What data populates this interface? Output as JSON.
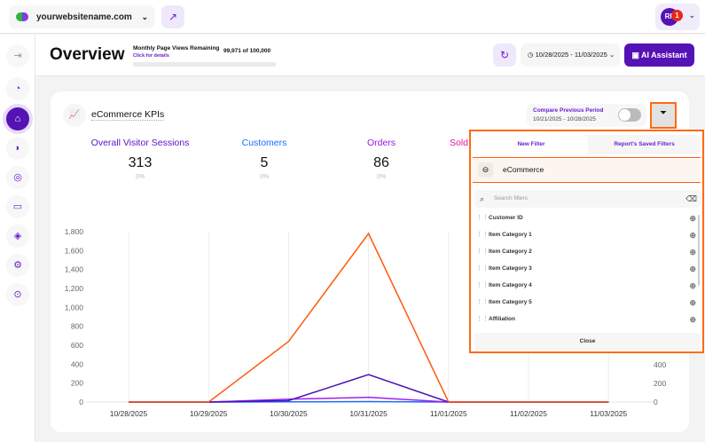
{
  "topbar": {
    "site": "yourwebsitename.com",
    "avatar_initials": "RF",
    "notification_count": "1"
  },
  "header": {
    "title": "Overview",
    "page_views_label": "Monthly Page Views Remaining",
    "page_views_link": "Click for details",
    "page_views_count": "99,971 of 100,000",
    "page_views_used_fraction": 0.0003,
    "date_range": "10/28/2025 - 11/03/2025",
    "ai_button": "AI Assistant"
  },
  "card": {
    "title": "eCommerce KPIs",
    "compare_label": "Compare Previous Period",
    "compare_range": "10/21/2025 - 10/28/2025",
    "compare_enabled": false,
    "kpis": [
      {
        "label": "Overall Visitor Sessions",
        "value": "313",
        "change": "0%",
        "color": "#5a0fc8"
      },
      {
        "label": "Customers",
        "value": "5",
        "change": "0%",
        "color": "#1a6bff"
      },
      {
        "label": "Orders",
        "value": "86",
        "change": "0%",
        "color": "#9b14e8"
      },
      {
        "label": "Sold",
        "value": "",
        "change": "",
        "color": "#e814a8"
      }
    ]
  },
  "filter_panel": {
    "tabs": [
      "New Filter",
      "Report's Saved Filters"
    ],
    "active_tab": "New Filter",
    "category": "eCommerce",
    "search_placeholder": "Search filters",
    "items": [
      "Customer ID",
      "Item Category 1",
      "Item Category 2",
      "Item Category 3",
      "Item Category 4",
      "Item Category 5",
      "Affiliation"
    ],
    "close": "Close"
  },
  "chart_data": {
    "type": "line",
    "x": [
      "10/28/2025",
      "10/29/2025",
      "10/30/2025",
      "10/31/2025",
      "11/01/2025",
      "11/02/2025",
      "11/03/2025"
    ],
    "y_left_ticks": [
      "0",
      "200",
      "400",
      "600",
      "800",
      "1,000",
      "1,200",
      "1,400",
      "1,600",
      "1,800"
    ],
    "ylim": [
      0,
      1800
    ],
    "y_right_ticks_visible": [
      "0",
      "200",
      "400"
    ],
    "series": [
      {
        "color": "#ff5a10",
        "values": [
          0,
          0,
          640,
          1780,
          0,
          0,
          0
        ]
      },
      {
        "color": "#4a10b8",
        "values": [
          0,
          0,
          15,
          290,
          0,
          0,
          0
        ]
      },
      {
        "color": "#a020f0",
        "values": [
          0,
          0,
          30,
          50,
          0,
          0,
          0
        ]
      },
      {
        "color": "#1a6bff",
        "values": [
          0,
          0,
          2,
          5,
          0,
          0,
          0
        ]
      }
    ],
    "grid": true
  }
}
